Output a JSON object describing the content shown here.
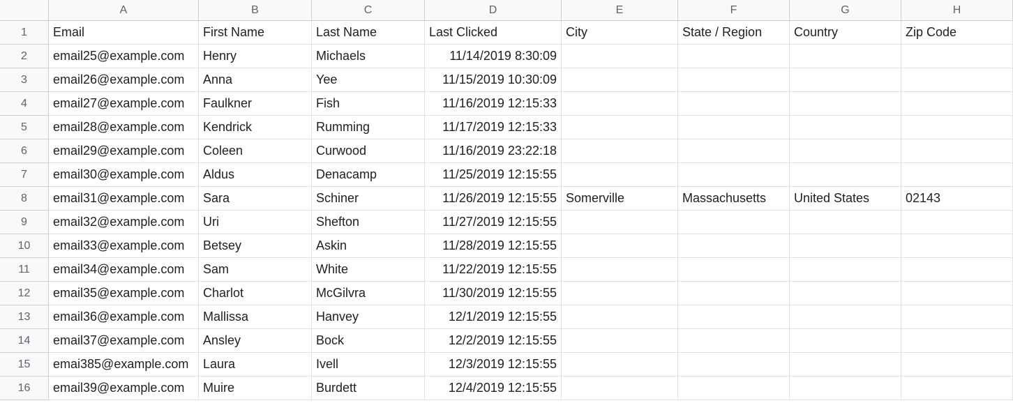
{
  "columns": {
    "A": "A",
    "B": "B",
    "C": "C",
    "D": "D",
    "E": "E",
    "F": "F",
    "G": "G",
    "H": "H"
  },
  "rownums": [
    "1",
    "2",
    "3",
    "4",
    "5",
    "6",
    "7",
    "8",
    "9",
    "10",
    "11",
    "12",
    "13",
    "14",
    "15",
    "16"
  ],
  "header": {
    "A": "Email",
    "B": "First Name",
    "C": "Last Name",
    "D": "Last Clicked",
    "E": "City",
    "F": "State / Region",
    "G": "Country",
    "H": "Zip Code"
  },
  "rows": [
    {
      "A": "email25@example.com",
      "B": "Henry",
      "C": "Michaels",
      "D": "11/14/2019 8:30:09",
      "E": "",
      "F": "",
      "G": "",
      "H": ""
    },
    {
      "A": "email26@example.com",
      "B": "Anna",
      "C": "Yee",
      "D": "11/15/2019 10:30:09",
      "E": "",
      "F": "",
      "G": "",
      "H": ""
    },
    {
      "A": "email27@example.com",
      "B": "Faulkner",
      "C": "Fish",
      "D": "11/16/2019 12:15:33",
      "E": "",
      "F": "",
      "G": "",
      "H": ""
    },
    {
      "A": "email28@example.com",
      "B": "Kendrick",
      "C": "Rumming",
      "D": "11/17/2019 12:15:33",
      "E": "",
      "F": "",
      "G": "",
      "H": ""
    },
    {
      "A": "email29@example.com",
      "B": "Coleen",
      "C": "Curwood",
      "D": "11/16/2019 23:22:18",
      "E": "",
      "F": "",
      "G": "",
      "H": ""
    },
    {
      "A": "email30@example.com",
      "B": "Aldus",
      "C": "Denacamp",
      "D": "11/25/2019 12:15:55",
      "E": "",
      "F": "",
      "G": "",
      "H": ""
    },
    {
      "A": "email31@example.com",
      "B": "Sara",
      "C": "Schiner",
      "D": "11/26/2019 12:15:55",
      "E": "Somerville",
      "F": "Massachusetts",
      "G": "United States",
      "H": "02143"
    },
    {
      "A": "email32@example.com",
      "B": "Uri",
      "C": "Shefton",
      "D": "11/27/2019 12:15:55",
      "E": "",
      "F": "",
      "G": "",
      "H": ""
    },
    {
      "A": "email33@example.com",
      "B": "Betsey",
      "C": "Askin",
      "D": "11/28/2019 12:15:55",
      "E": "",
      "F": "",
      "G": "",
      "H": ""
    },
    {
      "A": "email34@example.com",
      "B": "Sam",
      "C": "White",
      "D": "11/22/2019 12:15:55",
      "E": "",
      "F": "",
      "G": "",
      "H": ""
    },
    {
      "A": "email35@example.com",
      "B": "Charlot",
      "C": "McGilvra",
      "D": "11/30/2019 12:15:55",
      "E": "",
      "F": "",
      "G": "",
      "H": ""
    },
    {
      "A": "email36@example.com",
      "B": "Mallissa",
      "C": "Hanvey",
      "D": "12/1/2019 12:15:55",
      "E": "",
      "F": "",
      "G": "",
      "H": ""
    },
    {
      "A": "email37@example.com",
      "B": "Ansley",
      "C": "Bock",
      "D": "12/2/2019 12:15:55",
      "E": "",
      "F": "",
      "G": "",
      "H": ""
    },
    {
      "A": "emai385@example.com",
      "B": "Laura",
      "C": "Ivell",
      "D": "12/3/2019 12:15:55",
      "E": "",
      "F": "",
      "G": "",
      "H": ""
    },
    {
      "A": "email39@example.com",
      "B": "Muire",
      "C": "Burdett",
      "D": "12/4/2019 12:15:55",
      "E": "",
      "F": "",
      "G": "",
      "H": ""
    }
  ]
}
